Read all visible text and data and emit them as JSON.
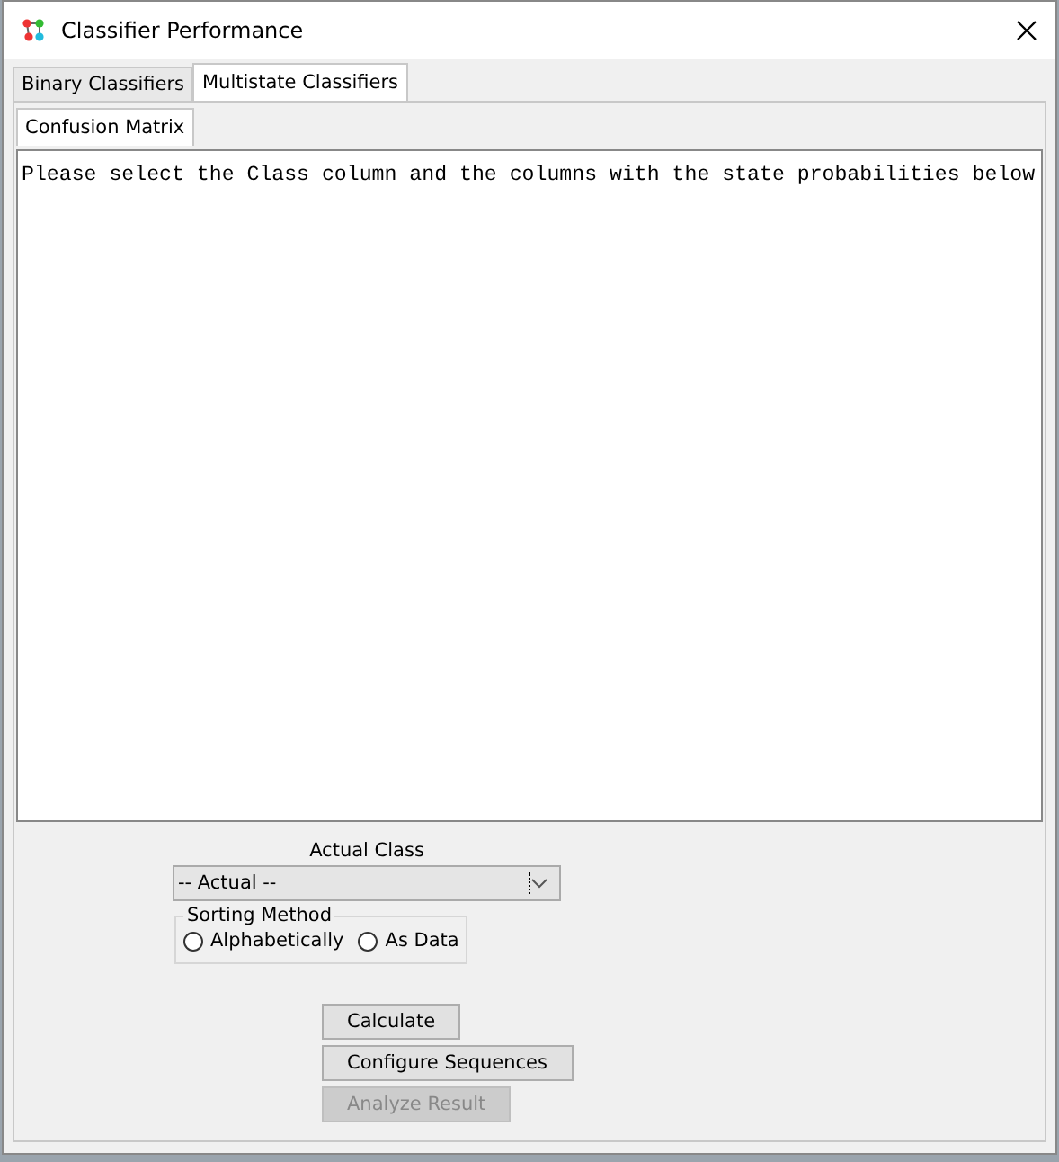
{
  "window": {
    "title": "Classifier Performance"
  },
  "tabs": [
    {
      "label": "Binary Classifiers",
      "selected": false
    },
    {
      "label": "Multistate Classifiers",
      "selected": true
    }
  ],
  "subtabs": [
    {
      "label": "Confusion Matrix",
      "selected": true
    }
  ],
  "output_text": "Please select the Class column and the columns with the state probabilities below",
  "actual_class": {
    "label": "Actual Class",
    "value": "-- Actual --"
  },
  "sorting_method": {
    "title": "Sorting Method",
    "options": [
      {
        "label": "Alphabetically",
        "selected": false
      },
      {
        "label": "As Data",
        "selected": false
      }
    ]
  },
  "buttons": [
    {
      "label": "Calculate",
      "disabled": false
    },
    {
      "label": "Configure Sequences",
      "disabled": false
    },
    {
      "label": "Analyze Result",
      "disabled": true
    }
  ]
}
